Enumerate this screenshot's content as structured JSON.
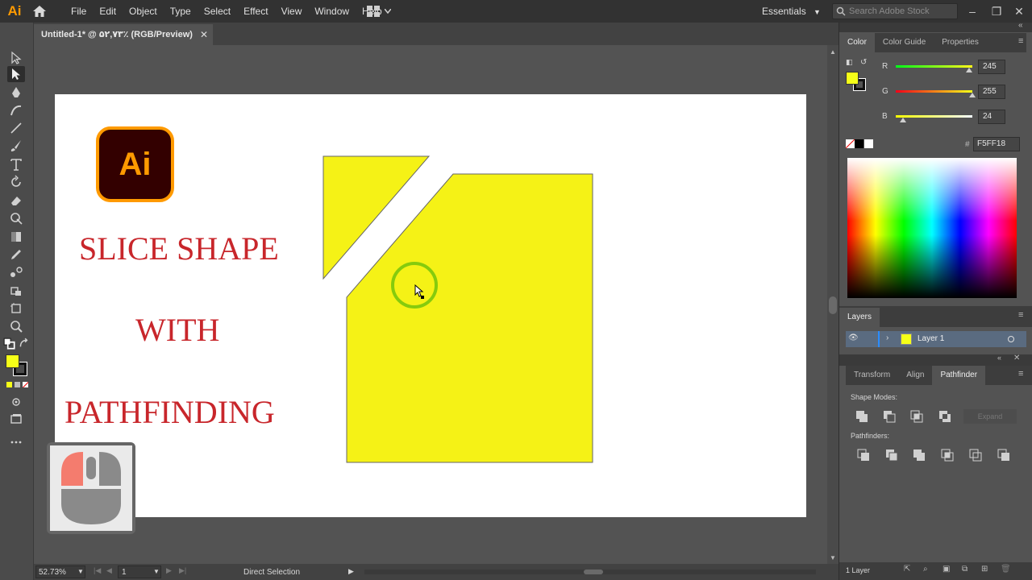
{
  "app": {
    "logo": "Ai",
    "home_icon": "home-icon"
  },
  "menu": [
    "File",
    "Edit",
    "Object",
    "Type",
    "Select",
    "Effect",
    "View",
    "Window",
    "Help"
  ],
  "workspace": {
    "name": "Essentials",
    "search_placeholder": "Search Adobe Stock"
  },
  "document": {
    "tab_title": "Untitled-1* @ ۵۲,۷۳٪ (RGB/Preview)",
    "close": "✕"
  },
  "artboard": {
    "logo_text": "Ai",
    "line1": "SLICE SHAPE",
    "line2": "WITH",
    "line3": "PATHFINDING",
    "shape_fill": "#F5F216"
  },
  "status": {
    "zoom": "52.73%",
    "artboard_num": "1",
    "tool": "Direct Selection"
  },
  "color_panel": {
    "tabs": [
      "Color",
      "Color Guide",
      "Properties"
    ],
    "active_tab": "Color",
    "r_label": "R",
    "g_label": "G",
    "b_label": "B",
    "r": "245",
    "g": "255",
    "b": "24",
    "r_fraction": 0.961,
    "g_fraction": 1.0,
    "b_fraction": 0.094,
    "hex_label": "#",
    "hex": "F5FF18",
    "fill_color": "#F5FF18"
  },
  "layers_panel": {
    "title": "Layers",
    "layer_name": "Layer 1",
    "footer_count": "1 Layer"
  },
  "pathfinder_panel": {
    "tabs": [
      "Transform",
      "Align",
      "Pathfinder"
    ],
    "active_tab": "Pathfinder",
    "shape_modes_label": "Shape Modes:",
    "pathfinders_label": "Pathfinders:",
    "expand_label": "Expand"
  },
  "colors": {
    "accent": "#ff9a00",
    "title_red": "#c8262b",
    "selection_green": "#7ac70c"
  }
}
